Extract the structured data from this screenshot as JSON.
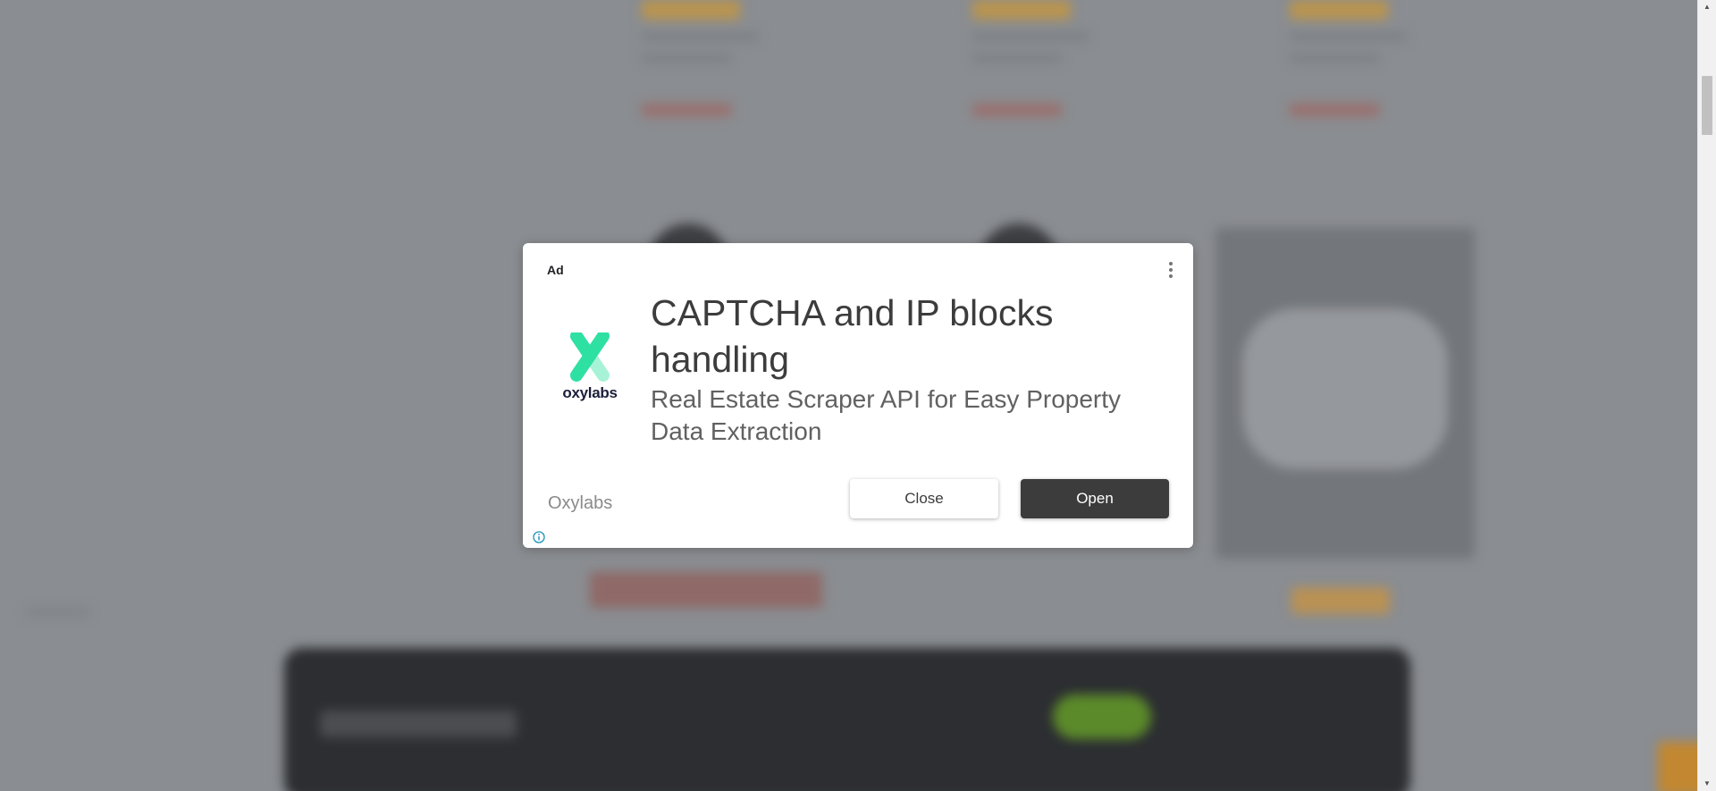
{
  "ad": {
    "label": "Ad",
    "headline": "CAPTCHA and IP blocks handling",
    "description": "Real Estate Scraper API for Easy Property Data Extraction",
    "advertiser": "Oxylabs",
    "logo_text": "oxylabs",
    "close_label": "Close",
    "open_label": "Open"
  },
  "icons": {
    "more": "more-vert-icon",
    "info": "info-icon",
    "logo": "oxylabs-logo-icon"
  },
  "colors": {
    "overlay": "#8a8d91",
    "open_button": "#3c3c3c",
    "logo_green": "#2fe0a3",
    "logo_light_green": "#a8f2d8",
    "logo_text": "#1b1f3a",
    "info_icon": "#1a8fb8"
  }
}
